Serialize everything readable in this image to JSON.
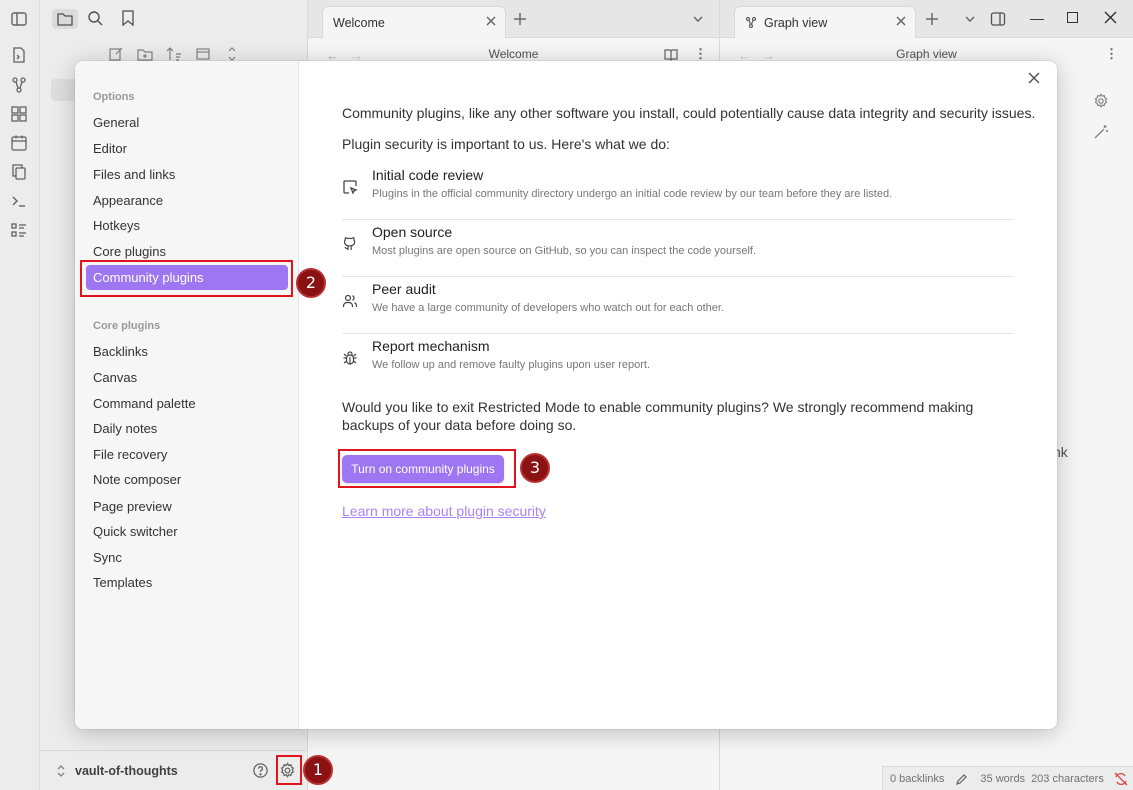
{
  "tabs": {
    "left_tab": "Welcome",
    "left_view_title": "Welcome",
    "right_tab": "Graph view",
    "right_view_title": "Graph view"
  },
  "right_pane_partial_text": "nk",
  "vault": {
    "name": "vault-of-thoughts"
  },
  "statusbar": {
    "backlinks": "0 backlinks",
    "words": "35 words",
    "characters": "203 characters"
  },
  "settings": {
    "options_heading": "Options",
    "options": [
      "General",
      "Editor",
      "Files and links",
      "Appearance",
      "Hotkeys",
      "Core plugins",
      "Community plugins"
    ],
    "active_option": "Community plugins",
    "core_heading": "Core plugins",
    "core_plugins": [
      "Backlinks",
      "Canvas",
      "Command palette",
      "Daily notes",
      "File recovery",
      "Note composer",
      "Page preview",
      "Quick switcher",
      "Sync",
      "Templates"
    ]
  },
  "community": {
    "intro": "Community plugins, like any other software you install, could potentially cause data integrity and security issues.",
    "security_line": "Plugin security is important to us. Here's what we do:",
    "features": [
      {
        "icon": "code-review-icon",
        "title": "Initial code review",
        "desc": "Plugins in the official community directory undergo an initial code review by our team before they are listed."
      },
      {
        "icon": "github-icon",
        "title": "Open source",
        "desc": "Most plugins are open source on GitHub, so you can inspect the code yourself."
      },
      {
        "icon": "users-icon",
        "title": "Peer audit",
        "desc": "We have a large community of developers who watch out for each other."
      },
      {
        "icon": "bug-icon",
        "title": "Report mechanism",
        "desc": "We follow up and remove faulty plugins upon user report."
      }
    ],
    "question": "Would you like to exit Restricted Mode to enable community plugins? We strongly recommend making backups of your data before doing so.",
    "button": "Turn on community plugins",
    "link": "Learn more about plugin security"
  },
  "annotations": {
    "badge1": "1",
    "badge2": "2",
    "badge3": "3"
  },
  "colors": {
    "accent": "#9f76f2",
    "highlight": "#e0151b",
    "badge": "#8a1212"
  }
}
